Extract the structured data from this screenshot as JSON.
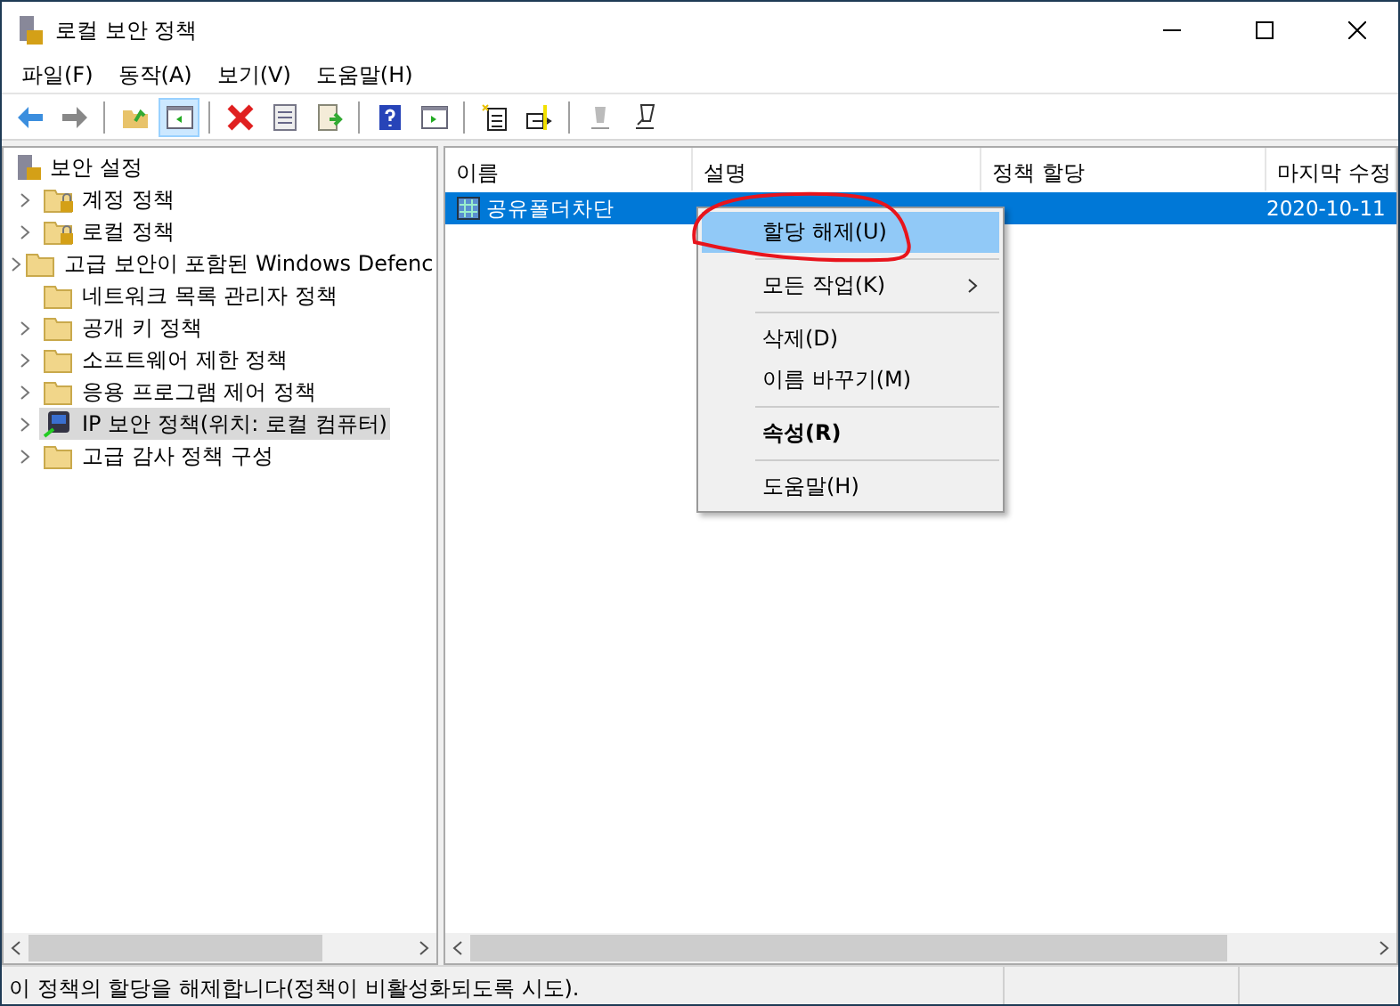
{
  "window": {
    "title": "로컬 보안 정책"
  },
  "menu": [
    "파일(F)",
    "동작(A)",
    "보기(V)",
    "도움말(H)"
  ],
  "toolbar": [
    {
      "kind": "back",
      "selected": false
    },
    {
      "kind": "forward",
      "selected": false
    },
    {
      "kind": "separator"
    },
    {
      "kind": "up",
      "selected": false
    },
    {
      "kind": "tree",
      "selected": true
    },
    {
      "kind": "separator"
    },
    {
      "kind": "delete",
      "selected": false
    },
    {
      "kind": "properties",
      "selected": false
    },
    {
      "kind": "export",
      "selected": false
    },
    {
      "kind": "separator"
    },
    {
      "kind": "help",
      "selected": false
    },
    {
      "kind": "panel",
      "selected": false
    },
    {
      "kind": "separator"
    },
    {
      "kind": "new",
      "selected": false
    },
    {
      "kind": "assign",
      "selected": false
    },
    {
      "kind": "separator"
    },
    {
      "kind": "tool",
      "selected": false
    },
    {
      "kind": "edit",
      "selected": false
    }
  ],
  "tree": {
    "root": "보안 설정",
    "items": [
      {
        "label": "계정 정책",
        "kind": "locked",
        "expandable": true,
        "selected": false
      },
      {
        "label": "로컬 정책",
        "kind": "locked",
        "expandable": true,
        "selected": false
      },
      {
        "label": "고급 보안이 포함된 Windows Defenc",
        "kind": "folder",
        "expandable": true,
        "selected": false
      },
      {
        "label": "네트워크 목록 관리자 정책",
        "kind": "folder",
        "expandable": false,
        "selected": false
      },
      {
        "label": "공개 키 정책",
        "kind": "folder",
        "expandable": true,
        "selected": false
      },
      {
        "label": "소프트웨어 제한 정책",
        "kind": "folder",
        "expandable": true,
        "selected": false
      },
      {
        "label": "응용 프로그램 제어 정책",
        "kind": "folder",
        "expandable": true,
        "selected": false
      },
      {
        "label": "IP 보안 정책(위치: 로컬 컴퓨터)",
        "kind": "ipsec",
        "expandable": true,
        "selected": true
      },
      {
        "label": "고급 감사 정책 구성",
        "kind": "folder",
        "expandable": true,
        "selected": false
      }
    ]
  },
  "table": {
    "columns": [
      "이름",
      "설명",
      "정책 할당",
      "마지막 수정"
    ],
    "rows": [
      {
        "name": "공유폴더차단",
        "modified": "2020-10-11",
        "selected": true
      }
    ]
  },
  "context_menu": [
    {
      "label": "할당 해제(U)",
      "kind": "item",
      "selected": true,
      "bold": false
    },
    {
      "kind": "separator"
    },
    {
      "label": "모든 작업(K)",
      "kind": "submenu",
      "selected": false,
      "bold": false
    },
    {
      "kind": "separator"
    },
    {
      "label": "삭제(D)",
      "kind": "item",
      "selected": false,
      "bold": false
    },
    {
      "label": "이름 바꾸기(M)",
      "kind": "item",
      "selected": false,
      "bold": false
    },
    {
      "kind": "separator"
    },
    {
      "label": "속성(R)",
      "kind": "item",
      "selected": false,
      "bold": true
    },
    {
      "kind": "separator"
    },
    {
      "label": "도움말(H)",
      "kind": "item",
      "selected": false,
      "bold": false
    }
  ],
  "status_bar": "이 정책의 할당을 해제합니다(정책이 비활성화되도록 시도)."
}
